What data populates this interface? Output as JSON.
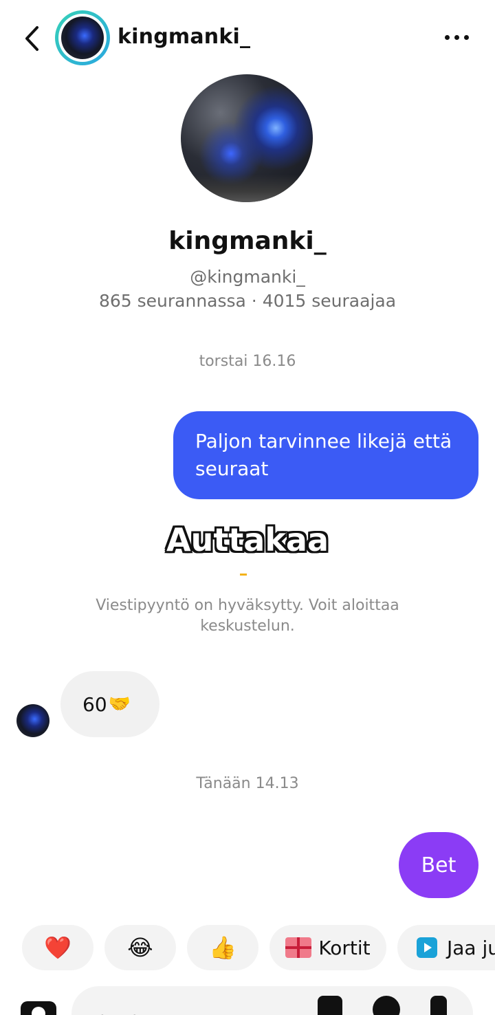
{
  "header": {
    "username": "kingmanki_",
    "back_icon": "chevron-left-icon",
    "more_icon": "more-horizontal-icon"
  },
  "profile": {
    "name": "kingmanki_",
    "handle": "@kingmanki_",
    "stats": "865 seurannassa · 4015 seuraajaa"
  },
  "messages": {
    "timestamp_1": "torstai 16.16",
    "sent_1": "Paljon tarvinnee likejä että seuraat",
    "sticker_text": "Auttakaa",
    "accepted_note": "Viestipyyntö on hyväksytty. Voit aloittaa keskustelun.",
    "received_1_text": "60",
    "received_1_emoji": "🤝",
    "timestamp_2": "Tänään 14.13",
    "sent_2": "Bet"
  },
  "quick_replies": {
    "heart": "❤️",
    "laugh": "😂",
    "thumbs_up": "👍",
    "cards_label": "Kortit",
    "share_label": "Jaa ju"
  },
  "input": {
    "placeholder": "Viesti..."
  },
  "colors": {
    "sent_bubble": "#3b5bf5",
    "sent_bubble_alt": "#8b3cf5",
    "received_bubble": "#f1f1f1",
    "avatar_ring": "#2aa7e0"
  }
}
